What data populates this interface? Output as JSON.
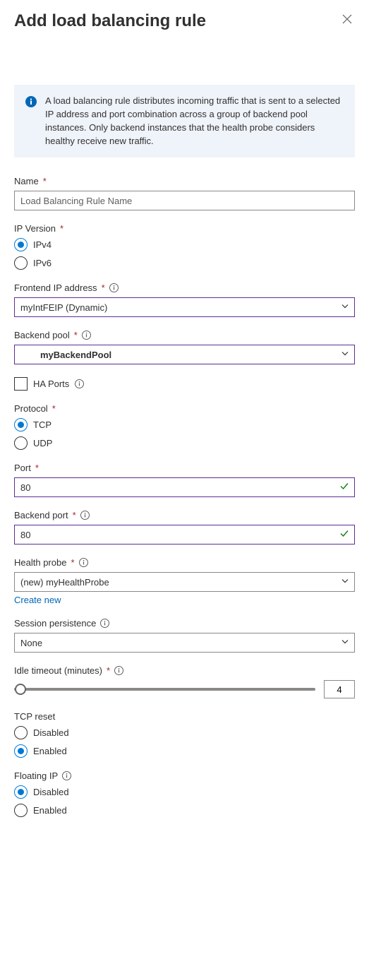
{
  "header": {
    "title": "Add load balancing rule"
  },
  "info": {
    "text": "A load balancing rule distributes incoming traffic that is sent to a selected IP address and port combination across a group of backend pool instances. Only backend instances that the health probe considers healthy receive new traffic."
  },
  "fields": {
    "name": {
      "label": "Name",
      "placeholder": "Load Balancing Rule Name",
      "value": ""
    },
    "ipVersion": {
      "label": "IP Version",
      "options": {
        "ipv4": "IPv4",
        "ipv6": "IPv6"
      },
      "selected": "ipv4"
    },
    "frontendIp": {
      "label": "Frontend IP address",
      "value": "myIntFEIP (Dynamic)"
    },
    "backendPool": {
      "label": "Backend pool",
      "value": "myBackendPool"
    },
    "haPorts": {
      "label": "HA Ports",
      "checked": false
    },
    "protocol": {
      "label": "Protocol",
      "options": {
        "tcp": "TCP",
        "udp": "UDP"
      },
      "selected": "tcp"
    },
    "port": {
      "label": "Port",
      "value": "80"
    },
    "backendPort": {
      "label": "Backend port",
      "value": "80"
    },
    "healthProbe": {
      "label": "Health probe",
      "value": "(new) myHealthProbe",
      "createNew": "Create new"
    },
    "sessionPersistence": {
      "label": "Session persistence",
      "value": "None"
    },
    "idleTimeout": {
      "label": "Idle timeout (minutes)",
      "value": "4"
    },
    "tcpReset": {
      "label": "TCP reset",
      "options": {
        "disabled": "Disabled",
        "enabled": "Enabled"
      },
      "selected": "enabled"
    },
    "floatingIp": {
      "label": "Floating IP",
      "options": {
        "disabled": "Disabled",
        "enabled": "Enabled"
      },
      "selected": "disabled"
    }
  }
}
